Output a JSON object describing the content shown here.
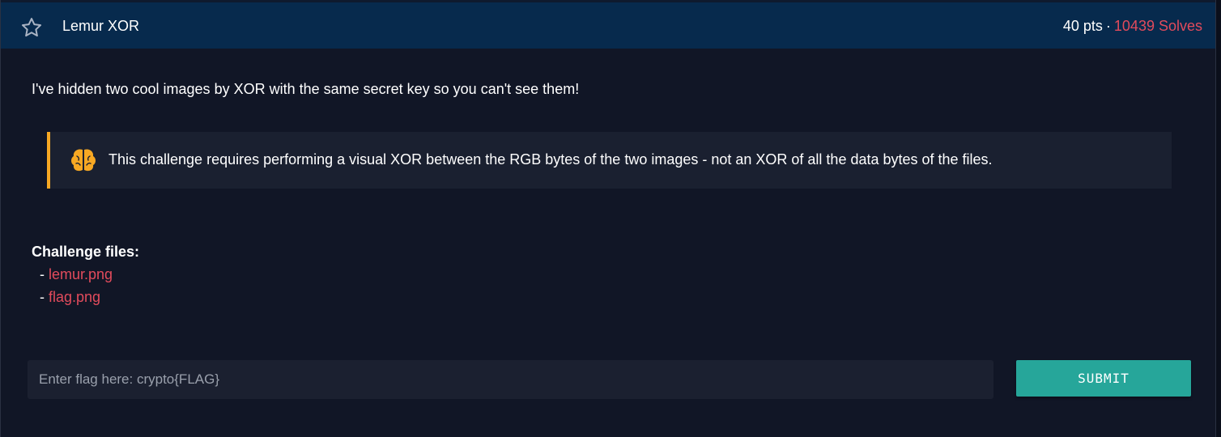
{
  "challenge": {
    "title": "Lemur XOR",
    "points": "40 pts",
    "separator": "·",
    "solves": "10439 Solves",
    "favorite_icon": "star-outline-icon"
  },
  "description": "I've hidden two cool images by XOR with the same secret key so you can't see them!",
  "note": {
    "icon": "brain-icon",
    "text": "This challenge requires performing a visual XOR between the RGB bytes of the two images - not an XOR of all the data bytes of the files."
  },
  "files": {
    "heading": "Challenge files:",
    "bullet": "-",
    "items": [
      {
        "name": "lemur.png"
      },
      {
        "name": "flag.png"
      }
    ]
  },
  "flag_form": {
    "placeholder": "Enter flag here: crypto{FLAG}",
    "value": "",
    "submit_label": "SUBMIT"
  },
  "colors": {
    "header_bg": "#072a4d",
    "page_bg": "#111626",
    "accent_red": "#e24b5c",
    "note_border": "#f7a823",
    "submit_bg": "#26a69a"
  }
}
